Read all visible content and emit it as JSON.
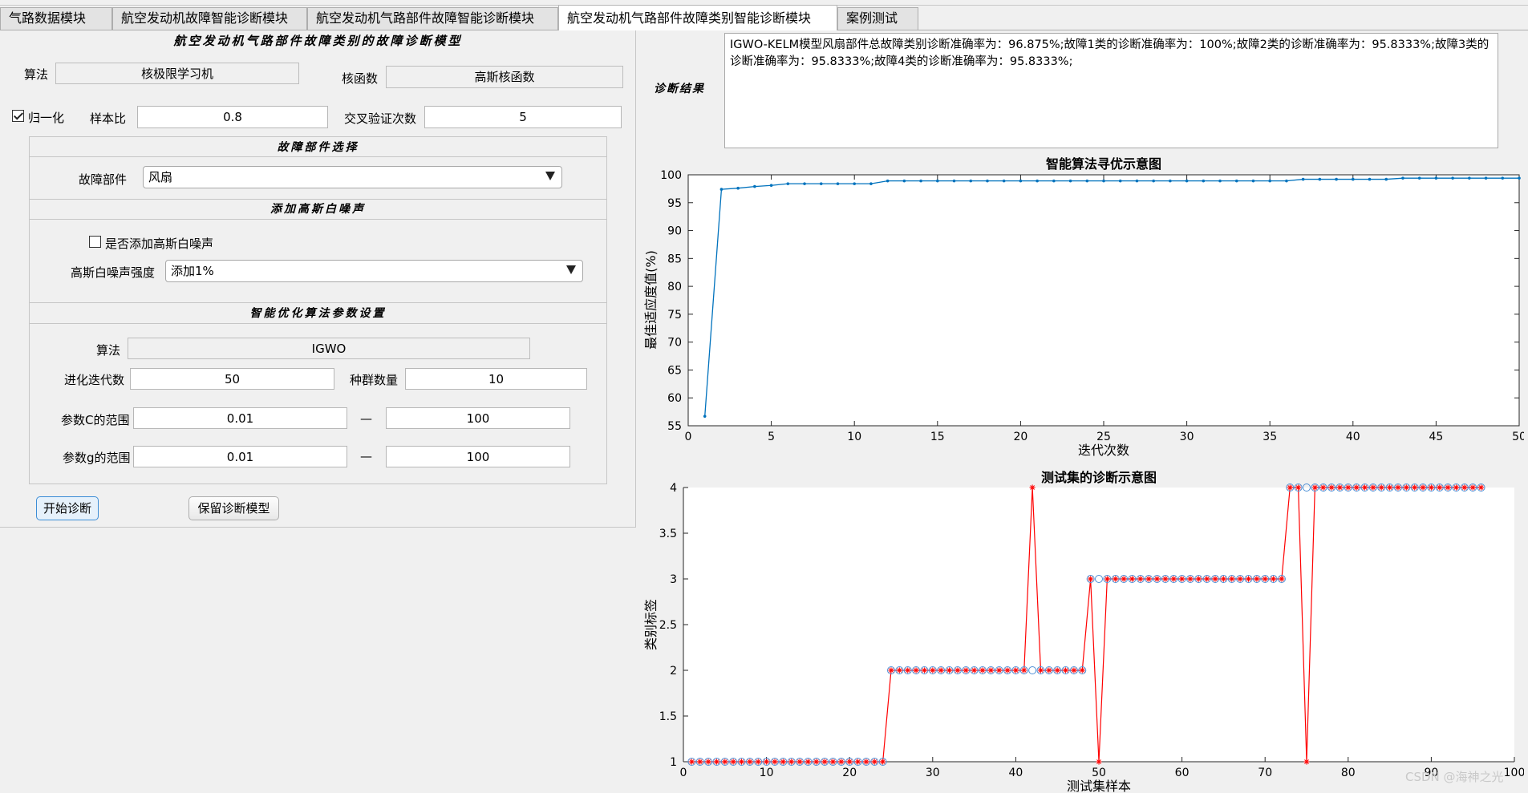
{
  "tabs": [
    {
      "label": "气路数据模块",
      "active": false
    },
    {
      "label": "航空发动机故障智能诊断模块",
      "active": false
    },
    {
      "label": "航空发动机气路部件故障智能诊断模块",
      "active": false
    },
    {
      "label": "航空发动机气路部件故障类别智能诊断模块",
      "active": true
    },
    {
      "label": "案例测试",
      "active": false
    }
  ],
  "model_panel": {
    "title": "航空发动机气路部件故障类别的故障诊断模型",
    "algorithm_label": "算法",
    "algorithm_value": "核极限学习机",
    "kernel_label": "核函数",
    "kernel_value": "高斯核函数",
    "normalize_label": "归一化",
    "normalize_checked": true,
    "sample_ratio_label": "样本比",
    "sample_ratio_value": "0.8",
    "cv_label": "交叉验证次数",
    "cv_value": "5"
  },
  "component_section": {
    "title": "故障部件选择",
    "label": "故障部件",
    "selected": "风扇"
  },
  "noise_section": {
    "title": "添加高斯白噪声",
    "checkbox_label": "是否添加高斯白噪声",
    "checkbox_checked": false,
    "strength_label": "高斯白噪声强度",
    "strength_selected": "添加1%"
  },
  "optimizer_section": {
    "title": "智能优化算法参数设置",
    "algorithm_label": "算法",
    "algorithm_value": "IGWO",
    "iterations_label": "进化迭代数",
    "iterations_value": "50",
    "population_label": "种群数量",
    "population_value": "10",
    "c_range_label": "参数C的范围",
    "c_min": "0.01",
    "c_max": "100",
    "g_range_label": "参数g的范围",
    "g_min": "0.01",
    "g_max": "100",
    "dash": "—"
  },
  "buttons": {
    "start": "开始诊断",
    "save": "保留诊断模型"
  },
  "result": {
    "label": "诊断结果",
    "text": "IGWO-KELM模型风扇部件总故障类别诊断准确率为：96.875%;故障1类的诊断准确率为：100%;故障2类的诊断准确率为：95.8333%;故障3类的诊断准确率为：95.8333%;故障4类的诊断准确率为：95.8333%;"
  },
  "colors": {
    "line_blue": "#0072bd",
    "red": "#ff0000",
    "circle": "#4d8fd6"
  },
  "watermark": "CSDN @海神之光",
  "chart_data": [
    {
      "type": "line",
      "title": "智能算法寻优示意图",
      "xlabel": "迭代次数",
      "ylabel": "最佳适应度值(%)",
      "xlim": [
        0,
        50
      ],
      "ylim": [
        55,
        100
      ],
      "xticks": [
        0,
        5,
        10,
        15,
        20,
        25,
        30,
        35,
        40,
        45,
        50
      ],
      "yticks": [
        55,
        60,
        65,
        70,
        75,
        80,
        85,
        90,
        95,
        100
      ],
      "series": [
        {
          "x": [
            1,
            2,
            3,
            4,
            5,
            6,
            7,
            8,
            9,
            10,
            11,
            12,
            13,
            14,
            15,
            16,
            17,
            18,
            19,
            20,
            21,
            22,
            23,
            24,
            25,
            26,
            27,
            28,
            29,
            30,
            31,
            32,
            33,
            34,
            35,
            36,
            37,
            38,
            39,
            40,
            41,
            42,
            43,
            44,
            45,
            46,
            47,
            48,
            49,
            50
          ],
          "y": [
            56.7,
            97.4,
            97.6,
            97.9,
            98.1,
            98.4,
            98.4,
            98.4,
            98.4,
            98.4,
            98.4,
            98.9,
            98.9,
            98.9,
            98.9,
            98.9,
            98.9,
            98.9,
            98.9,
            98.9,
            98.9,
            98.9,
            98.9,
            98.9,
            98.9,
            98.9,
            98.9,
            98.9,
            98.9,
            98.9,
            98.9,
            98.9,
            98.9,
            98.9,
            98.9,
            98.9,
            99.2,
            99.2,
            99.2,
            99.2,
            99.2,
            99.2,
            99.4,
            99.4,
            99.4,
            99.4,
            99.4,
            99.4,
            99.4,
            99.4
          ]
        }
      ]
    },
    {
      "type": "line",
      "title": "测试集的诊断示意图",
      "xlabel": "测试集样本",
      "ylabel": "类别标签",
      "xlim": [
        0,
        100
      ],
      "ylim": [
        1,
        4
      ],
      "xticks": [
        0,
        10,
        20,
        30,
        40,
        50,
        60,
        70,
        80,
        90,
        100
      ],
      "yticks": [
        1,
        1.5,
        2,
        2.5,
        3,
        3.5,
        4
      ],
      "n_samples": 96,
      "true_labels": [
        1,
        1,
        1,
        1,
        1,
        1,
        1,
        1,
        1,
        1,
        1,
        1,
        1,
        1,
        1,
        1,
        1,
        1,
        1,
        1,
        1,
        1,
        1,
        1,
        2,
        2,
        2,
        2,
        2,
        2,
        2,
        2,
        2,
        2,
        2,
        2,
        2,
        2,
        2,
        2,
        2,
        2,
        2,
        2,
        2,
        2,
        2,
        2,
        3,
        3,
        3,
        3,
        3,
        3,
        3,
        3,
        3,
        3,
        3,
        3,
        3,
        3,
        3,
        3,
        3,
        3,
        3,
        3,
        3,
        3,
        3,
        3,
        4,
        4,
        4,
        4,
        4,
        4,
        4,
        4,
        4,
        4,
        4,
        4,
        4,
        4,
        4,
        4,
        4,
        4,
        4,
        4,
        4,
        4,
        4,
        4
      ],
      "predicted_labels": [
        1,
        1,
        1,
        1,
        1,
        1,
        1,
        1,
        1,
        1,
        1,
        1,
        1,
        1,
        1,
        1,
        1,
        1,
        1,
        1,
        1,
        1,
        1,
        1,
        2,
        2,
        2,
        2,
        2,
        2,
        2,
        2,
        2,
        2,
        2,
        2,
        2,
        2,
        2,
        2,
        2,
        4,
        2,
        2,
        2,
        2,
        2,
        2,
        3,
        1,
        3,
        3,
        3,
        3,
        3,
        3,
        3,
        3,
        3,
        3,
        3,
        3,
        3,
        3,
        3,
        3,
        3,
        3,
        3,
        3,
        3,
        3,
        4,
        4,
        1,
        4,
        4,
        4,
        4,
        4,
        4,
        4,
        4,
        4,
        4,
        4,
        4,
        4,
        4,
        4,
        4,
        4,
        4,
        4,
        4,
        4
      ]
    }
  ]
}
